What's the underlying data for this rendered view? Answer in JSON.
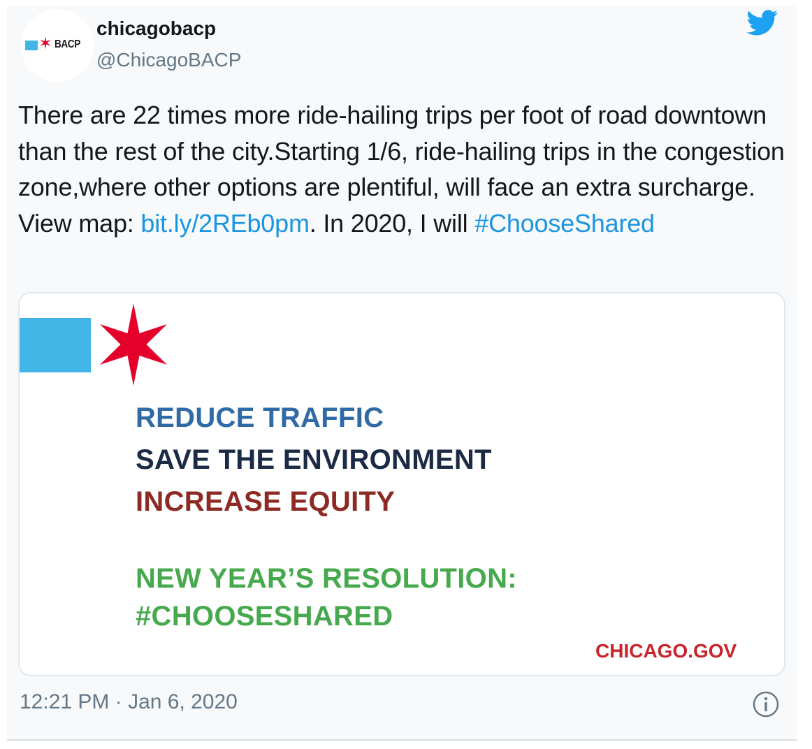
{
  "author": {
    "avatar_text": "BACP",
    "display_name": "chicagobacp",
    "handle": "@ChicagoBACP"
  },
  "tweet": {
    "text_part1": "There are 22 times more ride-hailing trips per foot of road downtown than the rest of the city.Starting 1/6, ride-hailing trips in the congestion zone,where other options are plentiful, will face an extra surcharge. View map: ",
    "link": "bit.ly/2REb0pm",
    "text_part2": ". In 2020, I will ",
    "hashtag": "#ChooseShared",
    "timestamp": "12:21 PM · Jan 6, 2020"
  },
  "media": {
    "line1": "REDUCE TRAFFIC",
    "line2": "SAVE THE ENVIRONMENT",
    "line3": "INCREASE EQUITY",
    "line4": "NEW YEAR’S RESOLUTION:",
    "line5": "#CHOOSESHARED",
    "footer": "CHICAGO.GOV"
  },
  "icons": {
    "brand": "twitter-bird-icon",
    "info": "info-icon",
    "star": "six-pointed-star-icon"
  },
  "colors": {
    "link": "#1b95e0",
    "flag_blue": "#41b6e6",
    "star_red": "#e4002b",
    "line1": "#2f6aa7",
    "line2": "#1c2b45",
    "line3": "#8e2a24",
    "green": "#47a94e",
    "gov": "#c8242b"
  }
}
